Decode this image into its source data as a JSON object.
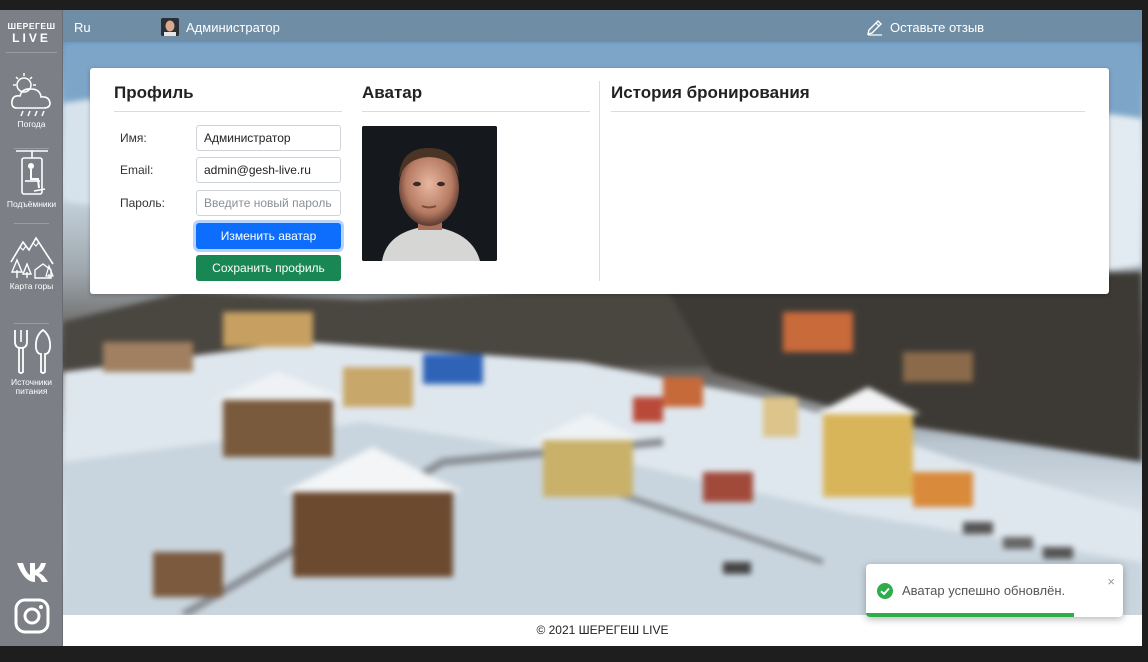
{
  "sidebar": {
    "logo_line1": "ШЕРЕГЕШ",
    "logo_line2": "LIVE",
    "items": [
      {
        "label": "Погода",
        "icon": "weather-icon"
      },
      {
        "label": "Подъёмники",
        "icon": "ski-lift-icon"
      },
      {
        "label": "Карта горы",
        "icon": "mountain-map-icon"
      },
      {
        "label": "Источники питания",
        "icon": "food-icon"
      }
    ],
    "social": [
      {
        "name": "vk-icon"
      },
      {
        "name": "instagram-icon"
      }
    ]
  },
  "header": {
    "language": "Ru",
    "username": "Администратор",
    "feedback_label": "Оставьте отзыв"
  },
  "profile": {
    "title": "Профиль",
    "name_label": "Имя:",
    "name_value": "Администратор",
    "email_label": "Email:",
    "email_value": "admin@gesh-live.ru",
    "password_label": "Пароль:",
    "password_placeholder": "Введите новый пароль",
    "change_avatar_label": "Изменить аватар",
    "save_profile_label": "Сохранить профиль"
  },
  "avatar_section": {
    "title": "Аватар"
  },
  "history": {
    "title": "История бронирования"
  },
  "footer": {
    "copyright": "© 2021 ШЕРЕГЕШ LIVE"
  },
  "toast": {
    "message": "Аватар успешно обновлён.",
    "close": "×",
    "progress_fraction": 0.81,
    "color": "#2ead4b"
  },
  "colors": {
    "sidebar": "#7d7f86",
    "primary_button": "#0d6efd",
    "success_button": "#198754"
  }
}
